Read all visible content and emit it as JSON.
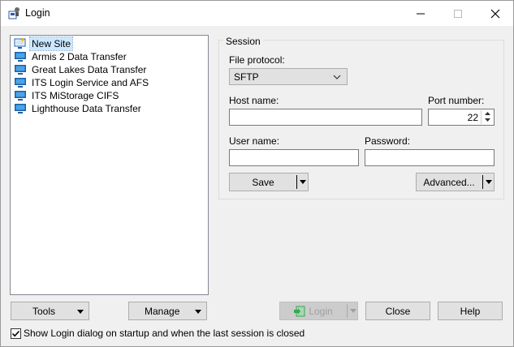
{
  "window": {
    "title": "Login",
    "min_symbol": "—",
    "max_symbol": "☐",
    "close_symbol": "✕"
  },
  "sites": [
    {
      "label": "New Site",
      "icon": "new-site-icon",
      "selected": true
    },
    {
      "label": "Armis 2 Data Transfer",
      "icon": "site-monitor-icon"
    },
    {
      "label": "Great Lakes Data Transfer",
      "icon": "site-monitor-icon"
    },
    {
      "label": "ITS Login Service and AFS",
      "icon": "site-monitor-icon"
    },
    {
      "label": "ITS MiStorage CIFS",
      "icon": "site-monitor-icon"
    },
    {
      "label": "Lighthouse Data Transfer",
      "icon": "site-monitor-icon"
    }
  ],
  "session": {
    "group_label": "Session",
    "file_protocol_label": "File protocol:",
    "file_protocol_value": "SFTP",
    "host_name_label": "Host name:",
    "host_name_value": "",
    "port_label": "Port number:",
    "port_value": "22",
    "user_name_label": "User name:",
    "user_name_value": "",
    "password_label": "Password:",
    "password_value": "",
    "save_label": "Save",
    "advanced_label": "Advanced..."
  },
  "footer": {
    "tools_label": "Tools",
    "manage_label": "Manage",
    "login_label": "Login",
    "close_label": "Close",
    "help_label": "Help",
    "show_login_label": "Show Login dialog on startup and when the last session is closed",
    "show_login_checked": true
  },
  "colors": {
    "selection": "#cce8ff",
    "window_bg": "#f0f0f0",
    "button_bg": "#e1e1e1",
    "login_icon_green": "#3aa655"
  }
}
